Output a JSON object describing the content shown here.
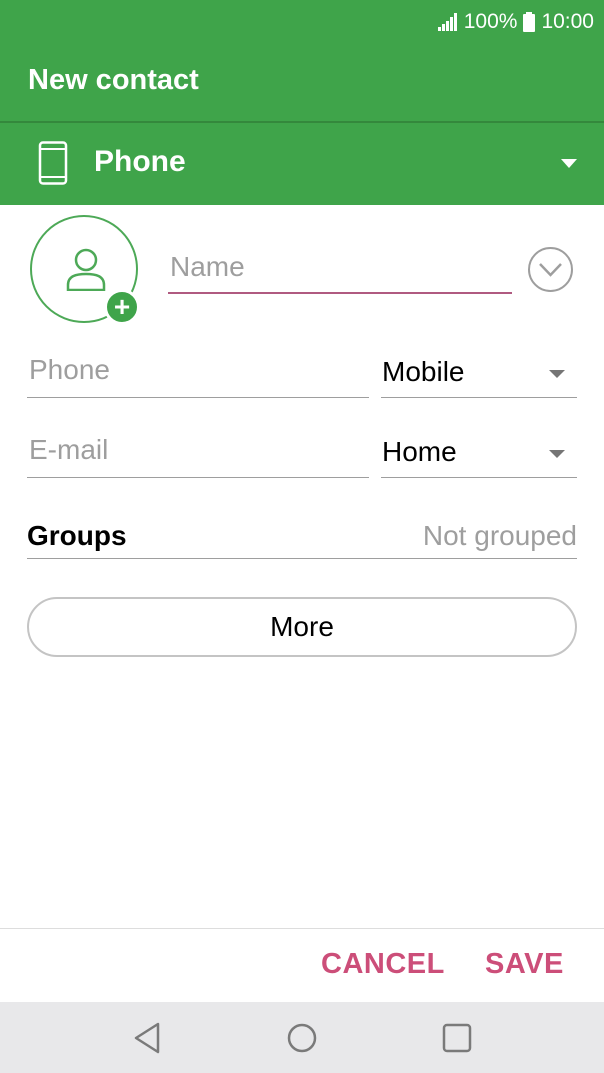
{
  "status_bar": {
    "battery_percent": "100%",
    "time": "10:00"
  },
  "header": {
    "title": "New contact"
  },
  "account": {
    "label": "Phone"
  },
  "form": {
    "name_placeholder": "Name",
    "phone_placeholder": "Phone",
    "phone_type": "Mobile",
    "email_placeholder": "E-mail",
    "email_type": "Home",
    "groups_label": "Groups",
    "groups_value": "Not grouped",
    "more_label": "More"
  },
  "actions": {
    "cancel_label": "CANCEL",
    "save_label": "SAVE"
  },
  "colors": {
    "appbar": "#3fa44a",
    "accent": "#cc4e79",
    "navbar": "#e8e8ea"
  }
}
